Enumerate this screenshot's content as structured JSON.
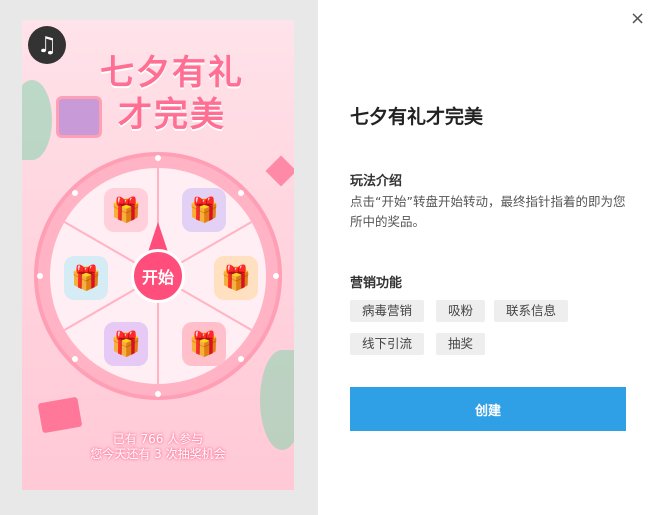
{
  "preview": {
    "title_line1": "七夕有礼",
    "title_line2": "才完美",
    "start_label": "开始",
    "footer_line1": "已有 766 人参与",
    "footer_line2": "您今天还有 3 次抽奖机会"
  },
  "panel": {
    "close_icon": "×",
    "title": "七夕有礼才完美",
    "howto_label": "玩法介绍",
    "howto_text": "点击“开始”转盘开始转动，最终指针指着的即为您所中的奖品。",
    "features_label": "营销功能",
    "tags": [
      "病毒营销",
      "吸粉",
      "联系信息",
      "线下引流",
      "抽奖"
    ],
    "create_label": "创建"
  },
  "colors": {
    "accent": "#2f9fe6",
    "brand_pink": "#ff4e7c"
  }
}
